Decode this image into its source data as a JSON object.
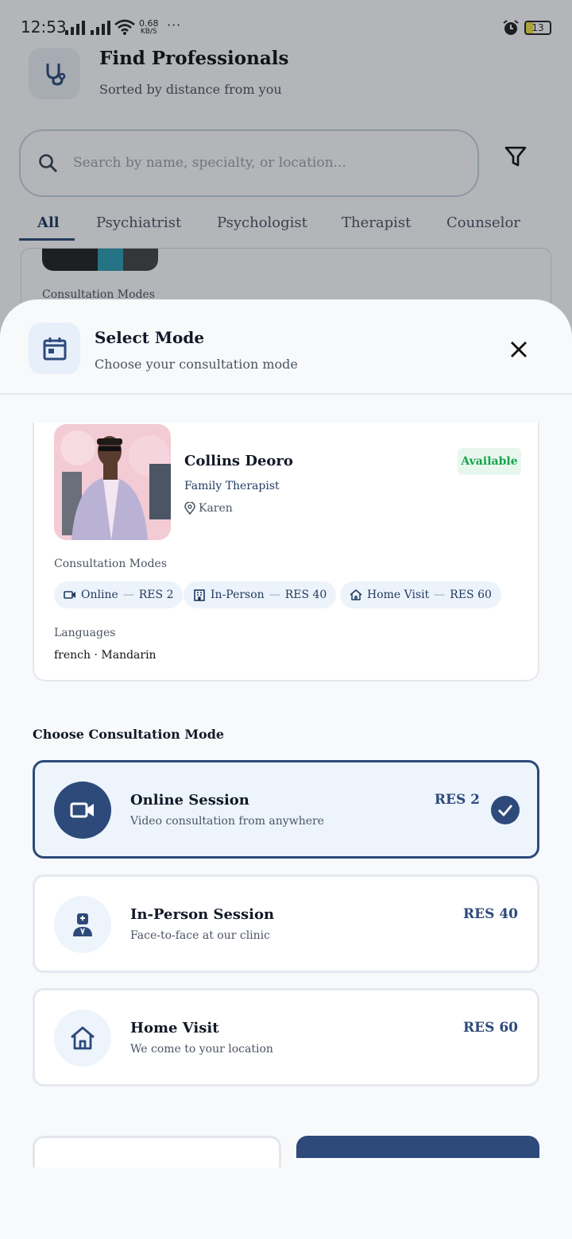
{
  "status_bar": {
    "time": "12:53",
    "net_speed_value": "0.68",
    "net_speed_unit": "KB/S",
    "more": "···",
    "battery": "13"
  },
  "header": {
    "title": "Find Professionals",
    "subtitle": "Sorted by distance from you",
    "icon": "stethoscope-icon"
  },
  "search": {
    "placeholder": "Search by name, specialty, or location..."
  },
  "tabs": [
    {
      "label": "All",
      "active": true
    },
    {
      "label": "Psychiatrist"
    },
    {
      "label": "Psychologist"
    },
    {
      "label": "Therapist"
    },
    {
      "label": "Counselor"
    }
  ],
  "background_card": {
    "modes_label": "Consultation Modes"
  },
  "sheet": {
    "title": "Select Mode",
    "subtitle": "Choose your consultation mode",
    "icon": "calendar-icon",
    "professional": {
      "name": "Collins Deoro",
      "role": "Family Therapist",
      "location": "Karen",
      "status": "Available",
      "modes_label": "Consultation Modes",
      "modes": [
        {
          "name": "Online",
          "price": "RES 2",
          "icon": "video-icon"
        },
        {
          "name": "In-Person",
          "price": "RES 40",
          "icon": "building-icon"
        },
        {
          "name": "Home Visit",
          "price": "RES 60",
          "icon": "home-icon"
        }
      ],
      "languages_label": "Languages",
      "languages": "french ·  Mandarin"
    },
    "choose_label": "Choose Consultation Mode",
    "options": [
      {
        "title": "Online Session",
        "desc": "Video consultation from anywhere",
        "price": "RES 2",
        "icon": "video-icon",
        "selected": true
      },
      {
        "title": "In-Person Session",
        "desc": "Face-to-face at our clinic",
        "price": "RES 40",
        "icon": "doctor-icon",
        "selected": false
      },
      {
        "title": "Home Visit",
        "desc": "We come to your location",
        "price": "RES 60",
        "icon": "home-icon",
        "selected": false
      }
    ]
  },
  "colors": {
    "primary": "#2d4a7a",
    "available": "#16a34a",
    "sheet_bg": "#f7f9fb"
  }
}
